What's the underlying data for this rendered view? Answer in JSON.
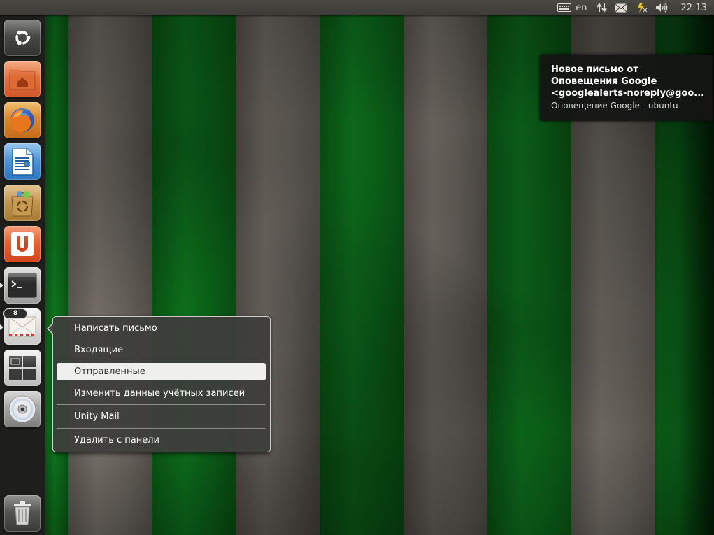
{
  "top_panel": {
    "indicators": [
      {
        "name": "keyboard-icon"
      },
      {
        "name": "language",
        "label": "en"
      },
      {
        "name": "network-icon"
      },
      {
        "name": "mail-icon"
      },
      {
        "name": "power-icon"
      },
      {
        "name": "volume-icon"
      }
    ],
    "clock": "22:13"
  },
  "launcher": {
    "items": [
      {
        "name": "ubuntu-dash",
        "icon": "ubuntu-logo-icon"
      },
      {
        "name": "home-folder",
        "icon": "home-folder-icon"
      },
      {
        "name": "firefox",
        "icon": "firefox-icon"
      },
      {
        "name": "libreoffice-writer",
        "icon": "writer-document-icon"
      },
      {
        "name": "software-center",
        "icon": "shopping-bag-icon"
      },
      {
        "name": "ubuntu-one",
        "icon": "ubuntu-one-icon"
      },
      {
        "name": "terminal",
        "icon": "terminal-icon"
      },
      {
        "name": "unity-mail",
        "icon": "envelope-icon",
        "badge": "8"
      },
      {
        "name": "workspace-switcher",
        "icon": "workspaces-icon"
      },
      {
        "name": "optical-disc",
        "icon": "cd-icon"
      },
      {
        "name": "trash",
        "icon": "trash-icon"
      }
    ]
  },
  "notification": {
    "title_line1": "Новое письмо от",
    "title_line2": "Оповещения Google",
    "title_line3": "<googlealerts-noreply@goo...",
    "body": "Оповещение Google - ubuntu"
  },
  "quicklist": {
    "items": [
      {
        "label": "Написать письмо"
      },
      {
        "label": "Входящие"
      },
      {
        "label": "Отправленные",
        "highlighted": true
      },
      {
        "label": "Изменить данные учётных записей"
      },
      {
        "label": "Unity Mail"
      },
      {
        "label": "Удалить с панели"
      }
    ]
  },
  "colors": {
    "panel": "#3c3b37",
    "stripe_green": "#0e7a1f",
    "stripe_gray": "#7a756c",
    "menu_bg": "#3e3e3c",
    "menu_highlight": "#efefed"
  }
}
